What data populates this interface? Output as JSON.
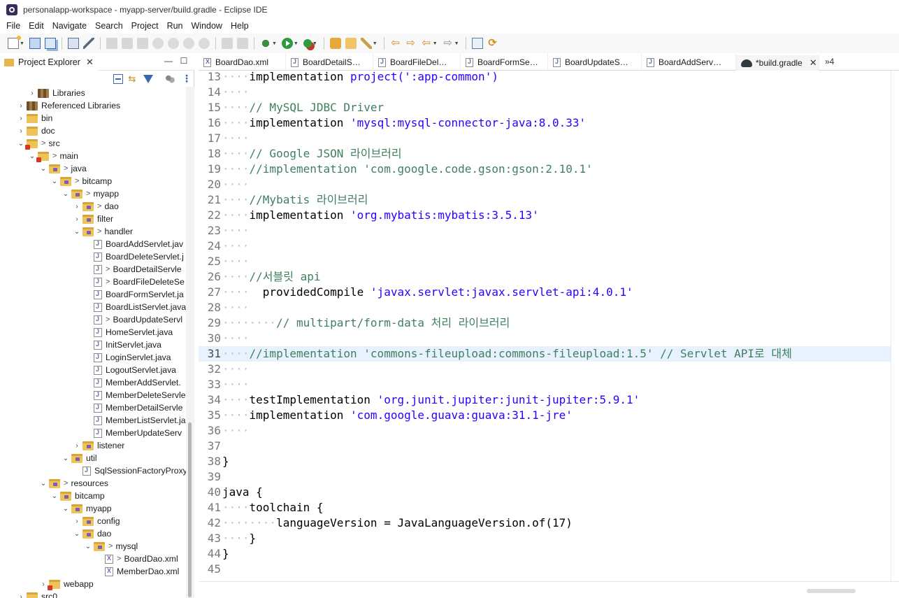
{
  "window": {
    "title": "personalapp-workspace - myapp-server/build.gradle - Eclipse IDE"
  },
  "menu": [
    "File",
    "Edit",
    "Navigate",
    "Search",
    "Project",
    "Run",
    "Window",
    "Help"
  ],
  "explorer": {
    "title": "Project Explorer",
    "close_glyph": "✕",
    "minimize_glyph": "—",
    "maximize_glyph": "☐",
    "tree": [
      {
        "label": "Libraries",
        "depth": 2,
        "twisty": "›",
        "icon": "libraries-icon",
        "mod": ""
      },
      {
        "label": "Referenced Libraries",
        "depth": 1,
        "twisty": "›",
        "icon": "libraries-icon",
        "mod": ""
      },
      {
        "label": "bin",
        "depth": 1,
        "twisty": "›",
        "icon": "folder-icon",
        "mod": ""
      },
      {
        "label": "doc",
        "depth": 1,
        "twisty": "›",
        "icon": "folder-icon",
        "mod": ""
      },
      {
        "label": "src",
        "depth": 1,
        "twisty": "⌄",
        "icon": "source-folder-error-icon",
        "mod": ">"
      },
      {
        "label": "main",
        "depth": 2,
        "twisty": "⌄",
        "icon": "source-folder-error-icon",
        "mod": ">"
      },
      {
        "label": "java",
        "depth": 3,
        "twisty": "⌄",
        "icon": "package-folder-icon",
        "mod": ">"
      },
      {
        "label": "bitcamp",
        "depth": 4,
        "twisty": "⌄",
        "icon": "package-folder-icon",
        "mod": ">"
      },
      {
        "label": "myapp",
        "depth": 5,
        "twisty": "⌄",
        "icon": "package-folder-icon",
        "mod": ">"
      },
      {
        "label": "dao",
        "depth": 6,
        "twisty": "›",
        "icon": "package-folder-icon",
        "mod": ">"
      },
      {
        "label": "filter",
        "depth": 6,
        "twisty": "›",
        "icon": "package-folder-icon",
        "mod": ""
      },
      {
        "label": "handler",
        "depth": 6,
        "twisty": "⌄",
        "icon": "package-folder-icon",
        "mod": ">"
      },
      {
        "label": "BoardAddServlet.jav",
        "depth": 7,
        "twisty": "",
        "icon": "java-file-icon",
        "mod": ""
      },
      {
        "label": "BoardDeleteServlet.j",
        "depth": 7,
        "twisty": "",
        "icon": "java-file-icon",
        "mod": ""
      },
      {
        "label": "BoardDetailServle",
        "depth": 7,
        "twisty": "",
        "icon": "java-file-icon",
        "mod": ">"
      },
      {
        "label": "BoardFileDeleteSe",
        "depth": 7,
        "twisty": "",
        "icon": "java-file-icon",
        "mod": ">"
      },
      {
        "label": "BoardFormServlet.ja",
        "depth": 7,
        "twisty": "",
        "icon": "java-file-icon",
        "mod": ""
      },
      {
        "label": "BoardListServlet.java",
        "depth": 7,
        "twisty": "",
        "icon": "java-file-icon",
        "mod": ""
      },
      {
        "label": "BoardUpdateServl",
        "depth": 7,
        "twisty": "",
        "icon": "java-file-icon",
        "mod": ">"
      },
      {
        "label": "HomeServlet.java",
        "depth": 7,
        "twisty": "",
        "icon": "java-file-icon",
        "mod": ""
      },
      {
        "label": "InitServlet.java",
        "depth": 7,
        "twisty": "",
        "icon": "java-file-icon",
        "mod": ""
      },
      {
        "label": "LoginServlet.java",
        "depth": 7,
        "twisty": "",
        "icon": "java-file-icon",
        "mod": ""
      },
      {
        "label": "LogoutServlet.java",
        "depth": 7,
        "twisty": "",
        "icon": "java-file-icon",
        "mod": ""
      },
      {
        "label": "MemberAddServlet.",
        "depth": 7,
        "twisty": "",
        "icon": "java-file-icon",
        "mod": ""
      },
      {
        "label": "MemberDeleteServle",
        "depth": 7,
        "twisty": "",
        "icon": "java-file-icon",
        "mod": ""
      },
      {
        "label": "MemberDetailServle",
        "depth": 7,
        "twisty": "",
        "icon": "java-file-icon",
        "mod": ""
      },
      {
        "label": "MemberListServlet.ja",
        "depth": 7,
        "twisty": "",
        "icon": "java-file-icon",
        "mod": ""
      },
      {
        "label": "MemberUpdateServ",
        "depth": 7,
        "twisty": "",
        "icon": "java-file-icon",
        "mod": ""
      },
      {
        "label": "listener",
        "depth": 6,
        "twisty": "›",
        "icon": "package-folder-icon",
        "mod": ""
      },
      {
        "label": "util",
        "depth": 5,
        "twisty": "⌄",
        "icon": "package-folder-icon",
        "mod": ""
      },
      {
        "label": "SqlSessionFactoryProxy",
        "depth": 6,
        "twisty": "",
        "icon": "java-file-icon",
        "mod": ""
      },
      {
        "label": "resources",
        "depth": 3,
        "twisty": "⌄",
        "icon": "package-folder-icon",
        "mod": ">"
      },
      {
        "label": "bitcamp",
        "depth": 4,
        "twisty": "⌄",
        "icon": "package-folder-icon",
        "mod": ""
      },
      {
        "label": "myapp",
        "depth": 5,
        "twisty": "⌄",
        "icon": "package-folder-icon",
        "mod": ""
      },
      {
        "label": "config",
        "depth": 6,
        "twisty": "›",
        "icon": "package-folder-icon",
        "mod": ""
      },
      {
        "label": "dao",
        "depth": 6,
        "twisty": "⌄",
        "icon": "package-folder-icon",
        "mod": ""
      },
      {
        "label": "mysql",
        "depth": 7,
        "twisty": "⌄",
        "icon": "package-folder-icon",
        "mod": ">"
      },
      {
        "label": "BoardDao.xml",
        "depth": 8,
        "twisty": "",
        "icon": "xml-file-icon",
        "mod": ">"
      },
      {
        "label": "MemberDao.xml",
        "depth": 8,
        "twisty": "",
        "icon": "xml-file-icon",
        "mod": ""
      },
      {
        "label": "webapp",
        "depth": 3,
        "twisty": "›",
        "icon": "source-folder-error-icon",
        "mod": ""
      },
      {
        "label": "src0",
        "depth": 1,
        "twisty": "›",
        "icon": "folder-icon",
        "mod": ""
      }
    ]
  },
  "editor": {
    "tabs": [
      {
        "label": "BoardDao.xml",
        "icon": "xml-file-icon",
        "active": false
      },
      {
        "label": "BoardDetailS…",
        "icon": "java-file-icon",
        "active": false
      },
      {
        "label": "BoardFileDel…",
        "icon": "java-file-icon",
        "active": false
      },
      {
        "label": "BoardFormSe…",
        "icon": "java-file-icon",
        "active": false
      },
      {
        "label": "BoardUpdateS…",
        "icon": "java-file-icon",
        "active": false
      },
      {
        "label": "BoardAddServ…",
        "icon": "java-file-icon",
        "active": false
      },
      {
        "label": "*build.gradle",
        "icon": "gradle-icon",
        "active": true
      }
    ],
    "overflow_label": "»4",
    "current_line": 31,
    "lines": [
      {
        "n": 13,
        "ws": "····",
        "tokens": [
          [
            "plain",
            "implementation "
          ],
          [
            "str",
            "project(':app-common')"
          ]
        ]
      },
      {
        "n": 14,
        "ws": "····",
        "tokens": []
      },
      {
        "n": 15,
        "ws": "····",
        "tokens": [
          [
            "comment",
            "// MySQL JDBC Driver"
          ]
        ]
      },
      {
        "n": 16,
        "ws": "····",
        "tokens": [
          [
            "plain",
            "implementation "
          ],
          [
            "str",
            "'mysql:mysql-connector-java:8.0.33'"
          ]
        ]
      },
      {
        "n": 17,
        "ws": "····",
        "tokens": []
      },
      {
        "n": 18,
        "ws": "····",
        "tokens": [
          [
            "comment",
            "// Google JSON 라이브러리"
          ]
        ]
      },
      {
        "n": 19,
        "ws": "····",
        "tokens": [
          [
            "comment",
            "//implementation 'com.google.code.gson:gson:2.10.1'"
          ]
        ]
      },
      {
        "n": 20,
        "ws": "····",
        "tokens": []
      },
      {
        "n": 21,
        "ws": "····",
        "tokens": [
          [
            "comment",
            "//Mybatis 라이브러리"
          ]
        ]
      },
      {
        "n": 22,
        "ws": "····",
        "tokens": [
          [
            "plain",
            "implementation "
          ],
          [
            "str",
            "'org.mybatis:mybatis:3.5.13'"
          ]
        ]
      },
      {
        "n": 23,
        "ws": "····",
        "tokens": []
      },
      {
        "n": 24,
        "ws": "····",
        "tokens": []
      },
      {
        "n": 25,
        "ws": "····",
        "tokens": []
      },
      {
        "n": 26,
        "ws": "····",
        "tokens": [
          [
            "comment",
            "//서블릿 api"
          ]
        ]
      },
      {
        "n": 27,
        "ws": "····",
        "tokens": [
          [
            "plain",
            "  providedCompile "
          ],
          [
            "str",
            "'javax.servlet:javax.servlet-api:4.0.1'"
          ]
        ]
      },
      {
        "n": 28,
        "ws": "····",
        "tokens": []
      },
      {
        "n": 29,
        "ws": "········",
        "tokens": [
          [
            "comment",
            "// multipart/form-data 처리 라이브러리"
          ]
        ]
      },
      {
        "n": 30,
        "ws": "····",
        "tokens": []
      },
      {
        "n": 31,
        "ws": "····",
        "tokens": [
          [
            "comment",
            "//implementation 'commons-fileupload:commons-fileupload:1.5' // Servlet API로 대체"
          ]
        ]
      },
      {
        "n": 32,
        "ws": "····",
        "tokens": []
      },
      {
        "n": 33,
        "ws": "····",
        "tokens": []
      },
      {
        "n": 34,
        "ws": "····",
        "tokens": [
          [
            "plain",
            "testImplementation "
          ],
          [
            "str",
            "'org.junit.jupiter:junit-jupiter:5.9.1'"
          ]
        ]
      },
      {
        "n": 35,
        "ws": "····",
        "tokens": [
          [
            "plain",
            "implementation "
          ],
          [
            "str",
            "'com.google.guava:guava:31.1-jre'"
          ]
        ]
      },
      {
        "n": 36,
        "ws": "····",
        "tokens": []
      },
      {
        "n": 37,
        "ws": "",
        "tokens": []
      },
      {
        "n": 38,
        "ws": "",
        "tokens": [
          [
            "plain",
            "}"
          ]
        ]
      },
      {
        "n": 39,
        "ws": "",
        "tokens": []
      },
      {
        "n": 40,
        "ws": "",
        "tokens": [
          [
            "plain",
            "java {"
          ]
        ]
      },
      {
        "n": 41,
        "ws": "····",
        "tokens": [
          [
            "plain",
            "toolchain {"
          ]
        ]
      },
      {
        "n": 42,
        "ws": "········",
        "tokens": [
          [
            "plain",
            "languageVersion = JavaLanguageVersion.of(17)"
          ]
        ]
      },
      {
        "n": 43,
        "ws": "····",
        "tokens": [
          [
            "plain",
            "}"
          ]
        ]
      },
      {
        "n": 44,
        "ws": "",
        "tokens": [
          [
            "plain",
            "}"
          ]
        ]
      },
      {
        "n": 45,
        "ws": "",
        "tokens": []
      }
    ]
  },
  "colors": {
    "string": "#2a00ff",
    "comment": "#3f7f5f",
    "current_line_bg": "#e8f2fe",
    "whitespace": "#c2c2c2"
  }
}
